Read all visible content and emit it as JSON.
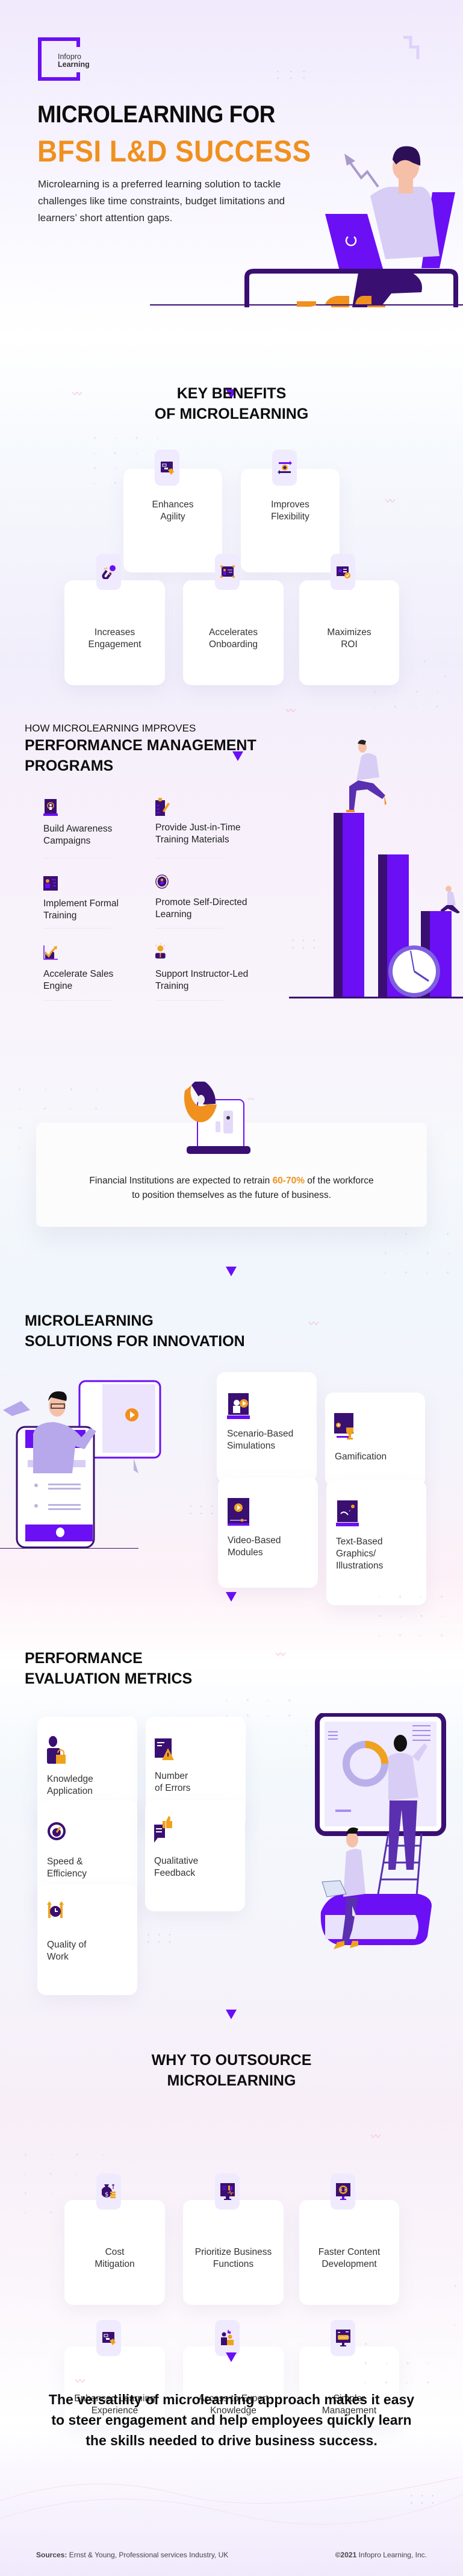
{
  "brand": {
    "logo_line1": "Infopro",
    "logo_line2": "Learning",
    "accent": "#6b0ff5",
    "orange": "#f0901e",
    "dark_purple": "#3a0f72"
  },
  "hero": {
    "title_line1": "MICROLEARNING FOR",
    "title_line2": "BFSI L&D SUCCESS",
    "intro": "Microlearning is a preferred learning solution to tackle challenges like time constraints, budget limitations and learners’ short attention gaps."
  },
  "benefits": {
    "heading_line1": "KEY BENEFITS",
    "heading_line2": "OF MICROLEARNING",
    "items": [
      {
        "label_line1": "Enhances",
        "label_line2": "Agility",
        "icon": "touch-screen-icon"
      },
      {
        "label_line1": "Improves",
        "label_line2": "Flexibility",
        "icon": "gear-arrows-icon"
      },
      {
        "label_line1": "Increases",
        "label_line2": "Engagement",
        "icon": "magnet-icon"
      },
      {
        "label_line1": "Accelerates",
        "label_line2": "Onboarding",
        "icon": "presentation-icon"
      },
      {
        "label_line1": "Maximizes",
        "label_line2": "ROI",
        "icon": "certificate-icon"
      }
    ]
  },
  "performance": {
    "subheading": "HOW MICROLEARNING IMPROVES",
    "heading_line1": "PERFORMANCE MANAGEMENT",
    "heading_line2": "PROGRAMS",
    "items": [
      {
        "label_line1": "Build Awareness",
        "label_line2": "Campaigns",
        "icon": "broadcast-laptop-icon"
      },
      {
        "label_line1": "Provide Just-in-Time",
        "label_line2": "Training Materials",
        "icon": "clipboard-check-icon"
      },
      {
        "label_line1": "Implement Formal",
        "label_line2": "Training",
        "icon": "id-card-icon"
      },
      {
        "label_line1": "Promote Self-Directed",
        "label_line2": "Learning",
        "icon": "person-target-icon"
      },
      {
        "label_line1": "Accelerate Sales",
        "label_line2": "Engine",
        "icon": "growth-chart-icon"
      },
      {
        "label_line1": "Support Instructor-Led",
        "label_line2": "Training",
        "icon": "idea-person-icon"
      }
    ]
  },
  "stat": {
    "text_before": "Financial Institutions are expected to retrain ",
    "highlight": "60-70%",
    "text_after": " of the workforce",
    "line2": "to position themselves as the future of business."
  },
  "solutions": {
    "heading_line1": "MICROLEARNING",
    "heading_line2": "SOLUTIONS FOR INNOVATION",
    "items": [
      {
        "label_line1": "Scenario-Based",
        "label_line2": "Simulations",
        "label_line3": "",
        "icon": "video-person-icon"
      },
      {
        "label_line1": "Gamification",
        "label_line2": "",
        "label_line3": "",
        "icon": "trophy-screen-icon"
      },
      {
        "label_line1": "Video-Based",
        "label_line2": "Modules",
        "label_line3": "",
        "icon": "video-player-icon"
      },
      {
        "label_line1": "Text-Based",
        "label_line2": "Graphics/",
        "label_line3": "Illustrations",
        "icon": "graphics-screen-icon"
      }
    ]
  },
  "metrics": {
    "heading_line1": "PERFORMANCE",
    "heading_line2": "EVALUATION METRICS",
    "items": [
      {
        "label_line1": "Knowledge",
        "label_line2": "Application",
        "icon": "person-lock-icon"
      },
      {
        "label_line1": "Number",
        "label_line2": "of Errors",
        "icon": "document-warning-icon"
      },
      {
        "label_line1": "Speed &",
        "label_line2": "Efficiency",
        "icon": "speedometer-icon"
      },
      {
        "label_line1": "Qualitative",
        "label_line2": "Feedback",
        "icon": "feedback-thumb-icon"
      },
      {
        "label_line1": "Quality of",
        "label_line2": "Work",
        "icon": "clock-arrows-icon"
      }
    ]
  },
  "outsource": {
    "heading_line1": "WHY TO OUTSOURCE",
    "heading_line2": "MICROLEARNING",
    "items": [
      {
        "label_line1": "Cost",
        "label_line2": "Mitigation",
        "icon": "money-bag-icon"
      },
      {
        "label_line1": "Prioritize Business",
        "label_line2": "Functions",
        "icon": "monitor-chart-icon"
      },
      {
        "label_line1": "Faster Content",
        "label_line2": "Development",
        "icon": "code-gear-icon"
      },
      {
        "label_line1": "Enhanced Learning",
        "label_line2": "Experience",
        "icon": "touch-screen-icon"
      },
      {
        "label_line1": "Access to Expert",
        "label_line2": "Knowledge",
        "icon": "experts-icon"
      },
      {
        "label_line1": "Simpler",
        "label_line2": "Management",
        "icon": "update-monitor-icon"
      }
    ]
  },
  "closing": {
    "text": "The versatility of microlearning approach makes it easy to steer engagement and help employees quickly learn the skills needed to drive business success."
  },
  "footer": {
    "sources_label": "Sources:",
    "sources_text": " Ernst & Young, Professional services Industry, UK",
    "copyright_year": "©2021",
    "copyright_text": " Infopro Learning, Inc."
  }
}
